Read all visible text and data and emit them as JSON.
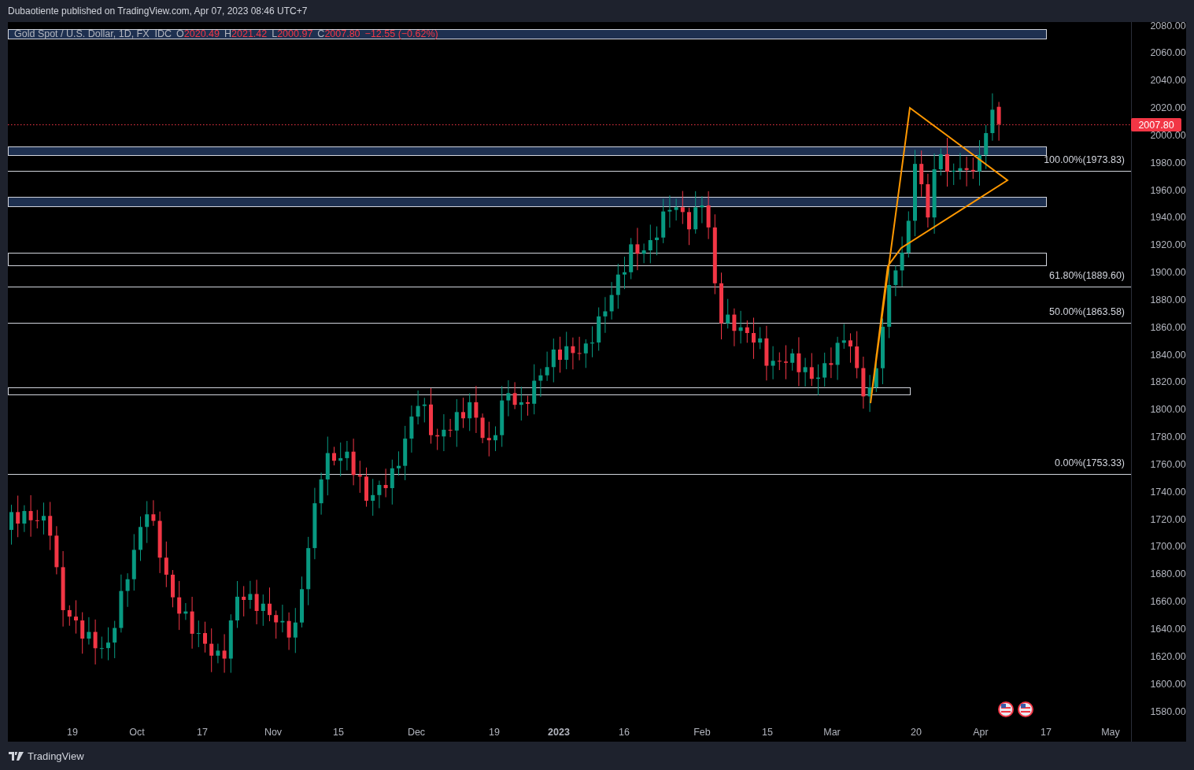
{
  "header": {
    "publisher_line": "Dubaotiente published on TradingView.com, Apr 07, 2023 08:46 UTC+7"
  },
  "legend": {
    "symbol": "Gold Spot / U.S. Dollar, 1D, FX_IDC",
    "ohlc": [
      {
        "key": "O",
        "value": "2020.49"
      },
      {
        "key": "H",
        "value": "2021.42"
      },
      {
        "key": "L",
        "value": "2000.97"
      },
      {
        "key": "C",
        "value": "2007.80"
      }
    ],
    "change": "−12.55 (−0.62%)"
  },
  "chart": {
    "price_labels": [
      "2080.00",
      "2060.00",
      "2040.00",
      "2020.00",
      "2000.00",
      "1980.00",
      "1960.00",
      "1940.00",
      "1920.00",
      "1900.00",
      "1880.00",
      "1860.00",
      "1840.00",
      "1820.00",
      "1800.00",
      "1780.00",
      "1760.00",
      "1740.00",
      "1720.00",
      "1700.00",
      "1680.00",
      "1660.00",
      "1640.00",
      "1620.00",
      "1600.00",
      "1580.00"
    ],
    "last_price": "2007.80",
    "fib_labels": [
      "100.00%(1973.83)",
      "61.80%(1889.60)",
      "50.00%(1863.58)",
      "0.00%(1753.33)"
    ],
    "time_labels": [
      {
        "text": "19",
        "kind": "day"
      },
      {
        "text": "Oct",
        "kind": "month"
      },
      {
        "text": "17",
        "kind": "day"
      },
      {
        "text": "Nov",
        "kind": "month"
      },
      {
        "text": "15",
        "kind": "day"
      },
      {
        "text": "Dec",
        "kind": "month"
      },
      {
        "text": "19",
        "kind": "day"
      },
      {
        "text": "2023",
        "kind": "year"
      },
      {
        "text": "16",
        "kind": "day"
      },
      {
        "text": "Feb",
        "kind": "month"
      },
      {
        "text": "15",
        "kind": "day"
      },
      {
        "text": "Mar",
        "kind": "month"
      },
      {
        "text": "20",
        "kind": "day"
      },
      {
        "text": "Apr",
        "kind": "month"
      },
      {
        "text": "17",
        "kind": "day"
      },
      {
        "text": "May",
        "kind": "month"
      }
    ]
  },
  "footer": {
    "brand": "TradingView"
  }
}
